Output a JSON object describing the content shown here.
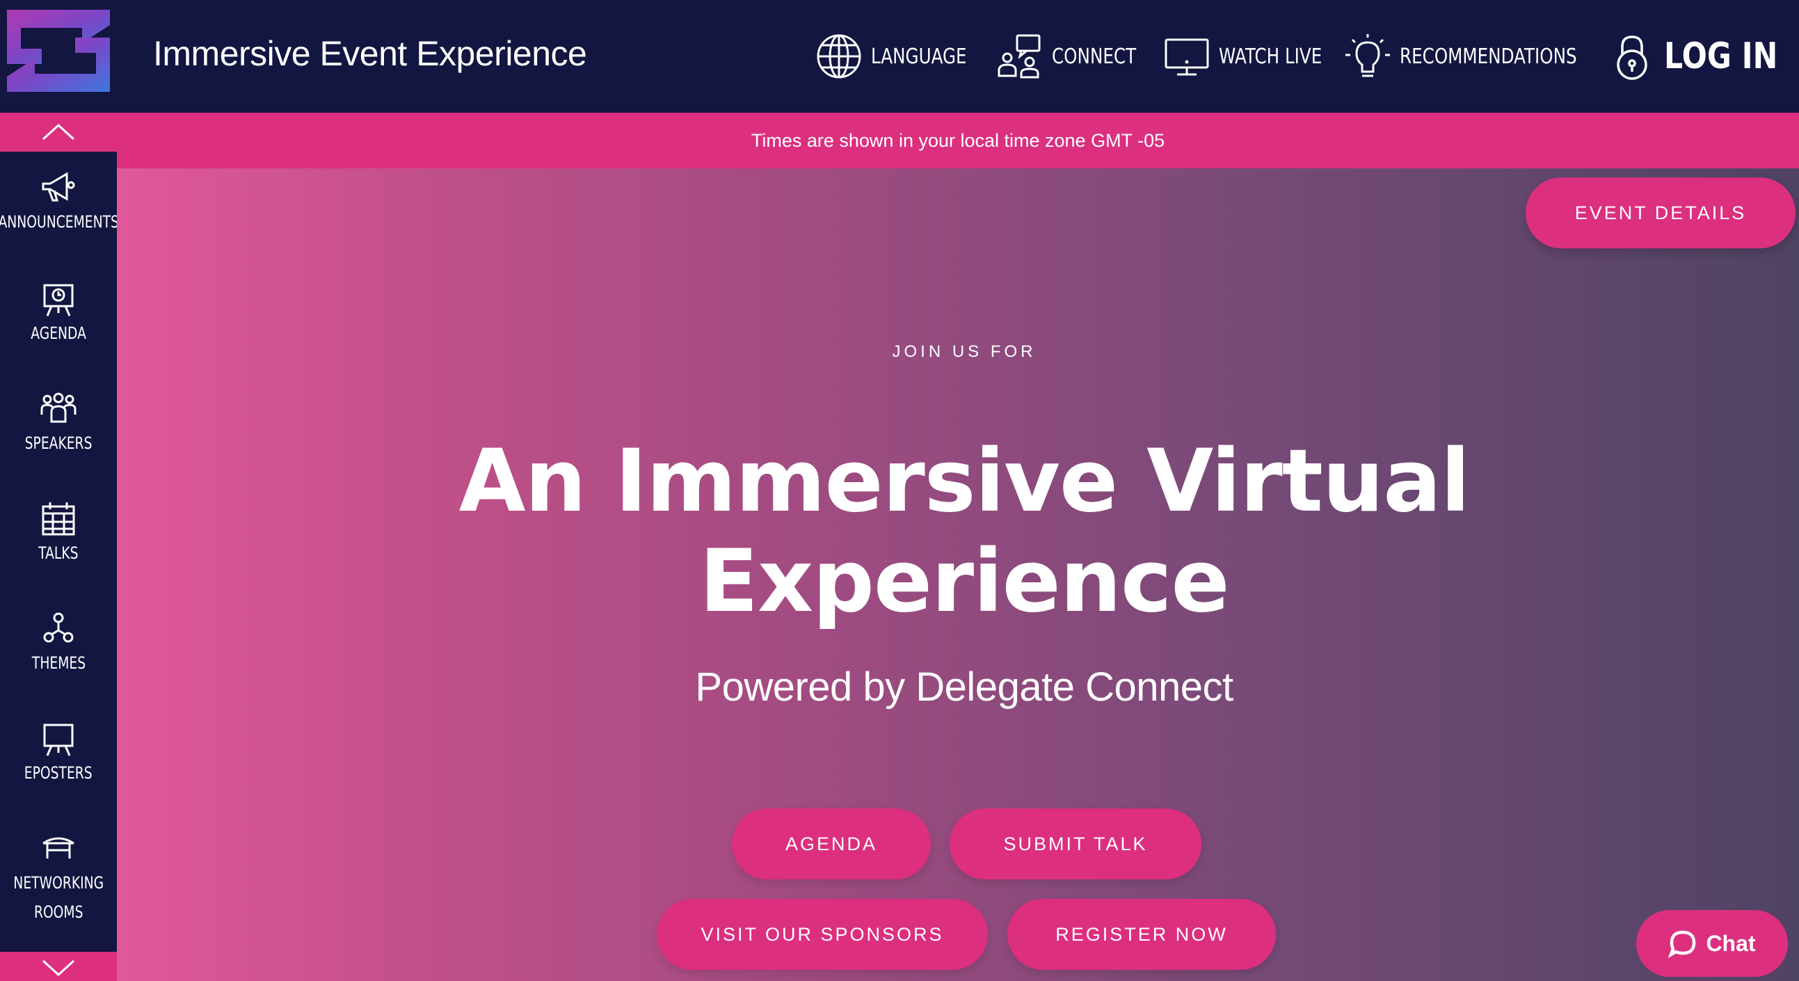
{
  "header": {
    "title": "Immersive Event Experience",
    "nav": [
      {
        "label": "LANGUAGE",
        "icon": "globe-icon"
      },
      {
        "label": "CONNECT",
        "icon": "connect-people-icon"
      },
      {
        "label": "WATCH LIVE",
        "icon": "monitor-icon"
      },
      {
        "label": "RECOMMENDATIONS",
        "icon": "lightbulb-icon"
      },
      {
        "label": "LOG IN",
        "icon": "lock-icon"
      }
    ]
  },
  "sidebar": {
    "items": [
      {
        "label": "ANNOUNCEMENTS",
        "icon": "megaphone-icon"
      },
      {
        "label": "AGENDA",
        "icon": "presentation-clock-icon"
      },
      {
        "label": "SPEAKERS",
        "icon": "people-group-icon"
      },
      {
        "label": "TALKS",
        "icon": "calendar-icon"
      },
      {
        "label": "THEMES",
        "icon": "nodes-icon"
      },
      {
        "label": "EPOSTERS",
        "icon": "easel-icon"
      },
      {
        "label": "NETWORKING",
        "label2": "ROOMS",
        "icon": "table-icon"
      }
    ]
  },
  "banner": {
    "timezone_text": "Times are shown in your local time zone GMT -05"
  },
  "hero": {
    "event_details_label": "EVENT DETAILS",
    "kicker": "JOIN US FOR",
    "headline_line1": "An Immersive Virtual",
    "headline_line2": "Experience",
    "subheadline": "Powered by Delegate Connect",
    "buttons": {
      "agenda": "AGENDA",
      "submit_talk": "SUBMIT TALK",
      "visit_sponsors": "VISIT OUR SPONSORS",
      "register_now": "REGISTER NOW"
    }
  },
  "chat": {
    "label": "Chat",
    "icon": "speech-bubble-icon"
  },
  "colors": {
    "navy": "#121640",
    "accent_pink": "#dc2f7e",
    "logo_purple": "#a033b8",
    "logo_blue": "#3c6fd6"
  }
}
